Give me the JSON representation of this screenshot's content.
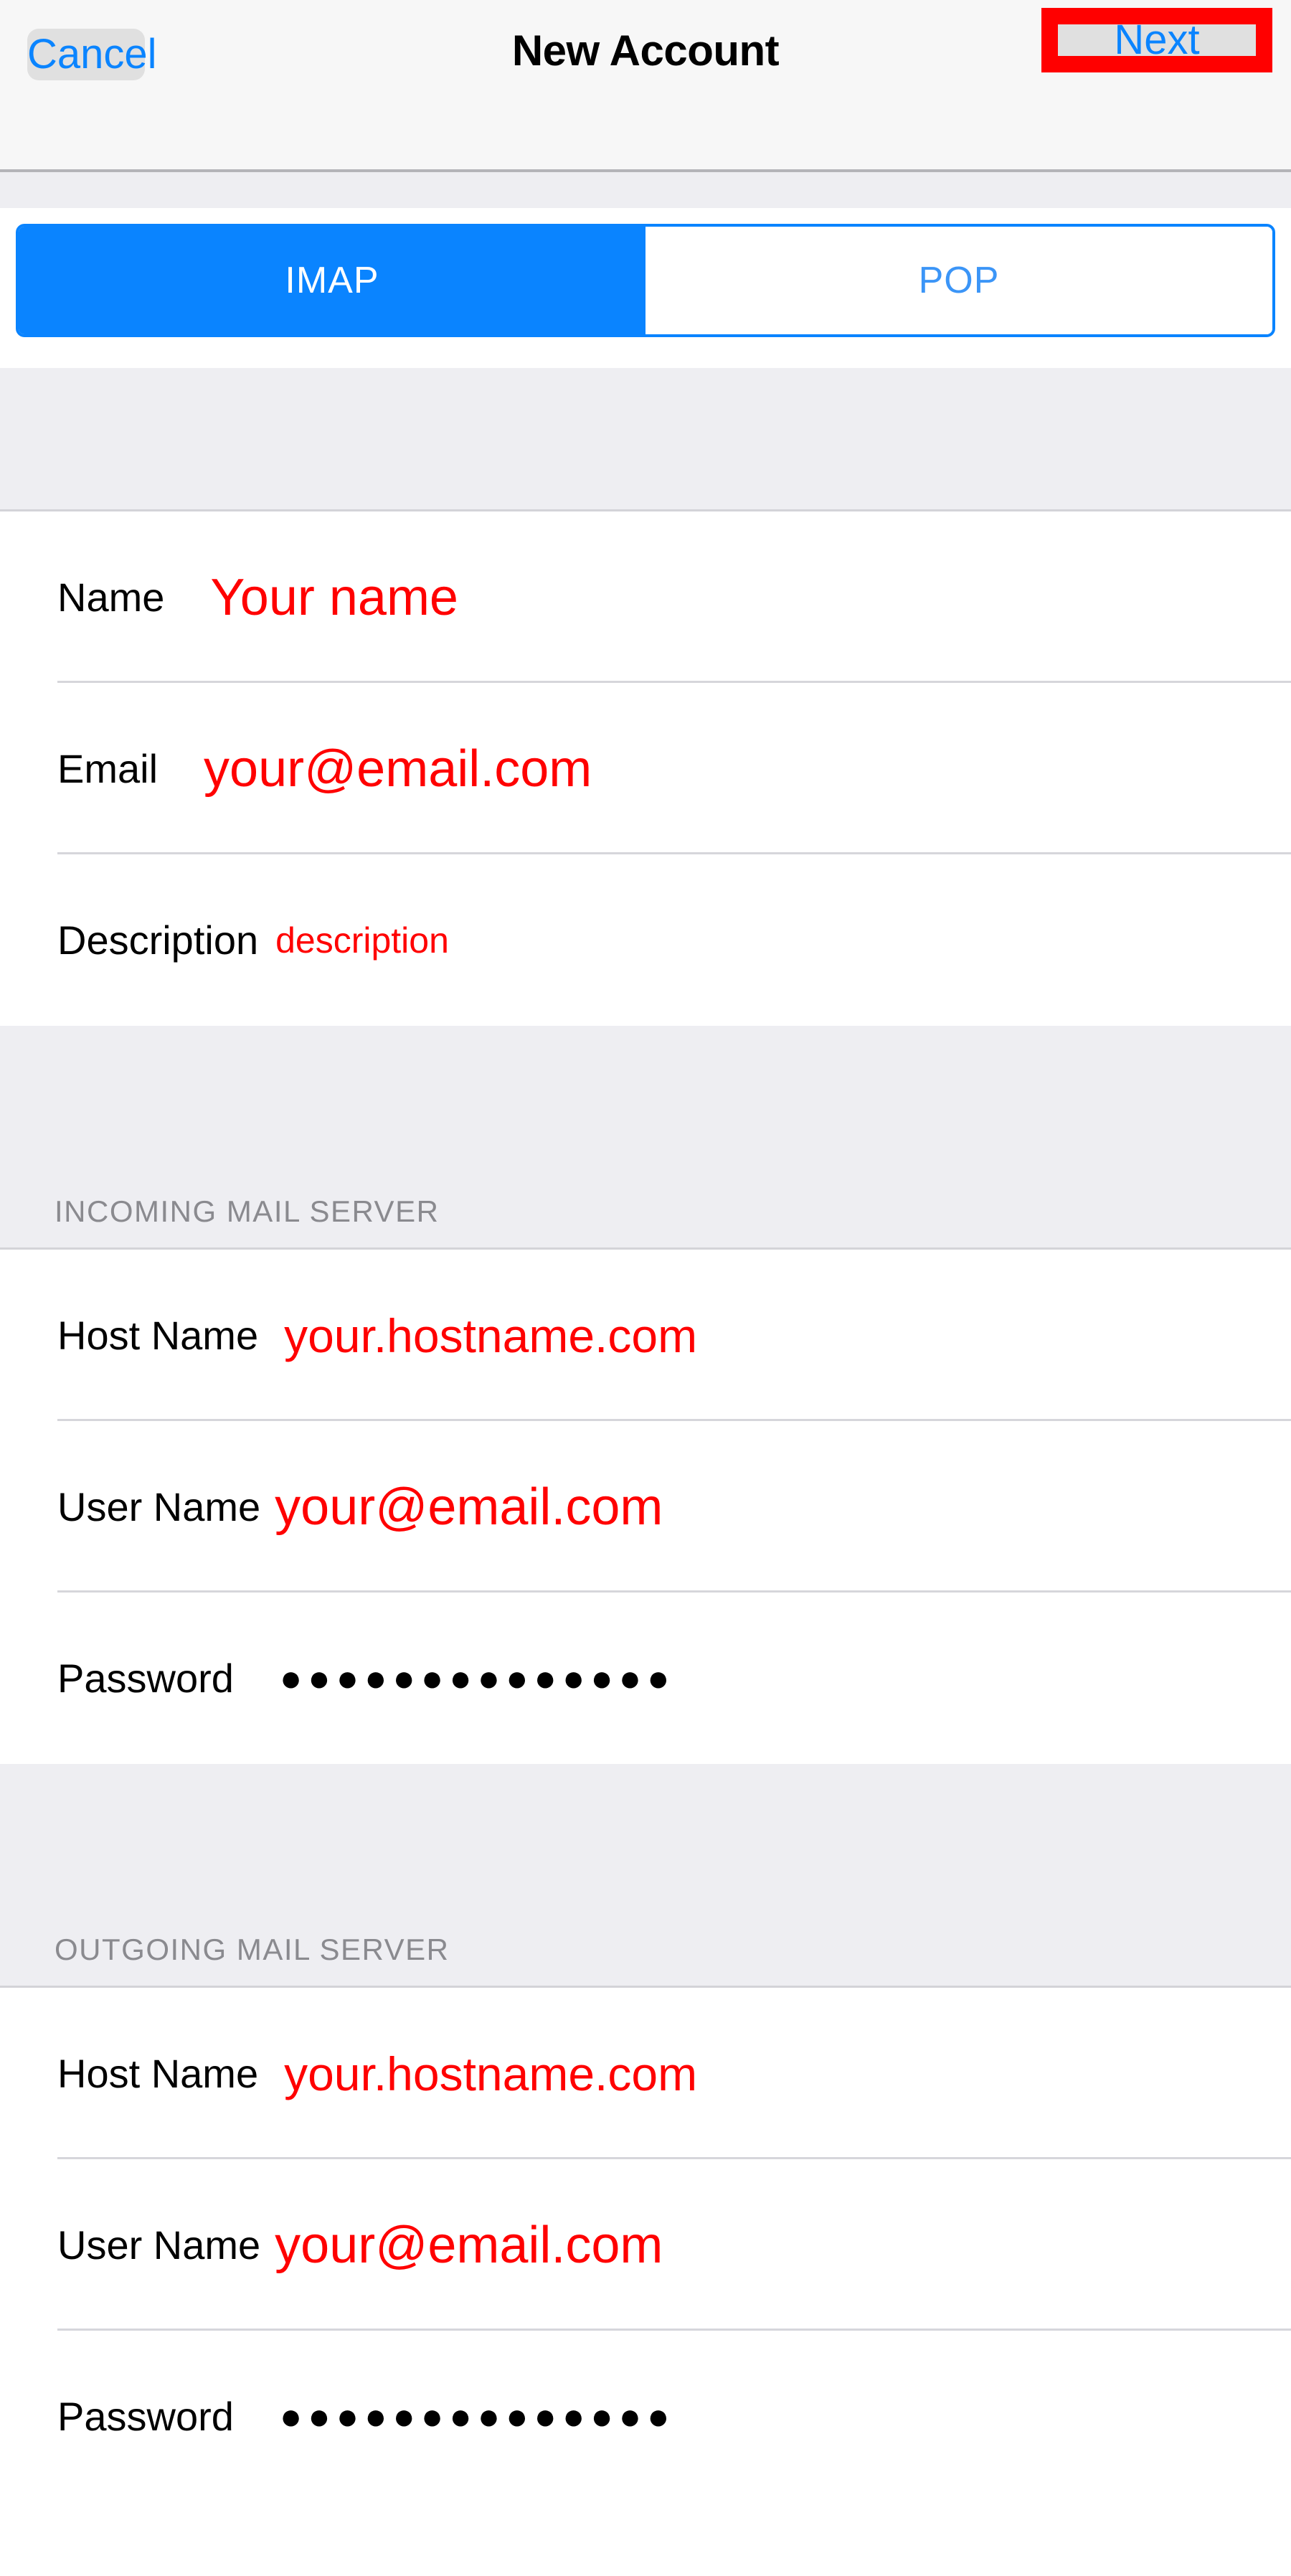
{
  "navbar": {
    "cancel_label": "Cancel",
    "title": "New Account",
    "next_label": "Next",
    "highlight_color": "#ff0000",
    "tint_color": "#0a84ff"
  },
  "segmented_control": {
    "options": [
      "IMAP",
      "POP"
    ],
    "selected": "IMAP",
    "imap_label": "IMAP",
    "pop_label": "POP",
    "active_bg": "#0a84ff",
    "inactive_fg": "#3b95f7"
  },
  "account_section": {
    "rows": [
      {
        "label": "Name",
        "value": "Your name"
      },
      {
        "label": "Email",
        "value": "your@email.com"
      },
      {
        "label": "Description",
        "value": "description"
      }
    ]
  },
  "incoming_section": {
    "header": "INCOMING MAIL SERVER",
    "rows": [
      {
        "label": "Host Name",
        "value": "your.hostname.com"
      },
      {
        "label": "User Name",
        "value": "your@email.com"
      },
      {
        "label": "Password",
        "value": "●●●●●●●●●●●●●●"
      }
    ]
  },
  "outgoing_section": {
    "header": "OUTGOING MAIL SERVER",
    "rows": [
      {
        "label": "Host Name",
        "value": "your.hostname.com"
      },
      {
        "label": "User Name",
        "value": "your@email.com"
      },
      {
        "label": "Password",
        "value": "●●●●●●●●●●●●●●"
      }
    ]
  },
  "colors": {
    "value_red": "#ff0000",
    "label_black": "#000000",
    "section_header_gray": "#8a8a8f",
    "page_bg": "#eeeef2",
    "row_bg": "#ffffff"
  }
}
